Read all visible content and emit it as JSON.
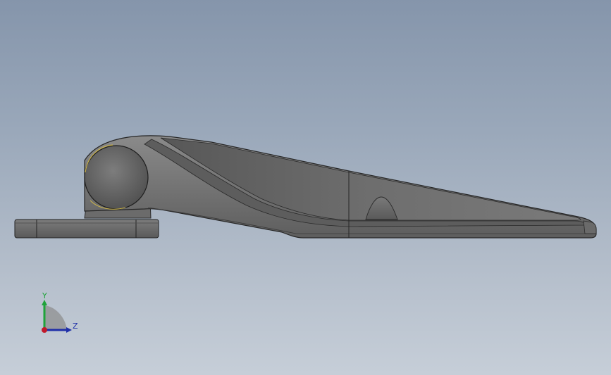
{
  "viewport": {
    "background_top": "#8595ab",
    "background_bottom": "#c6ced8",
    "part_color": "#6f6f6f",
    "edge_color": "#2a2a2a"
  },
  "triad": {
    "y_label": "Y",
    "z_label": "Z",
    "y_color": "#1fa33a",
    "z_color": "#1f2fa8",
    "x_color": "#c0192b"
  }
}
